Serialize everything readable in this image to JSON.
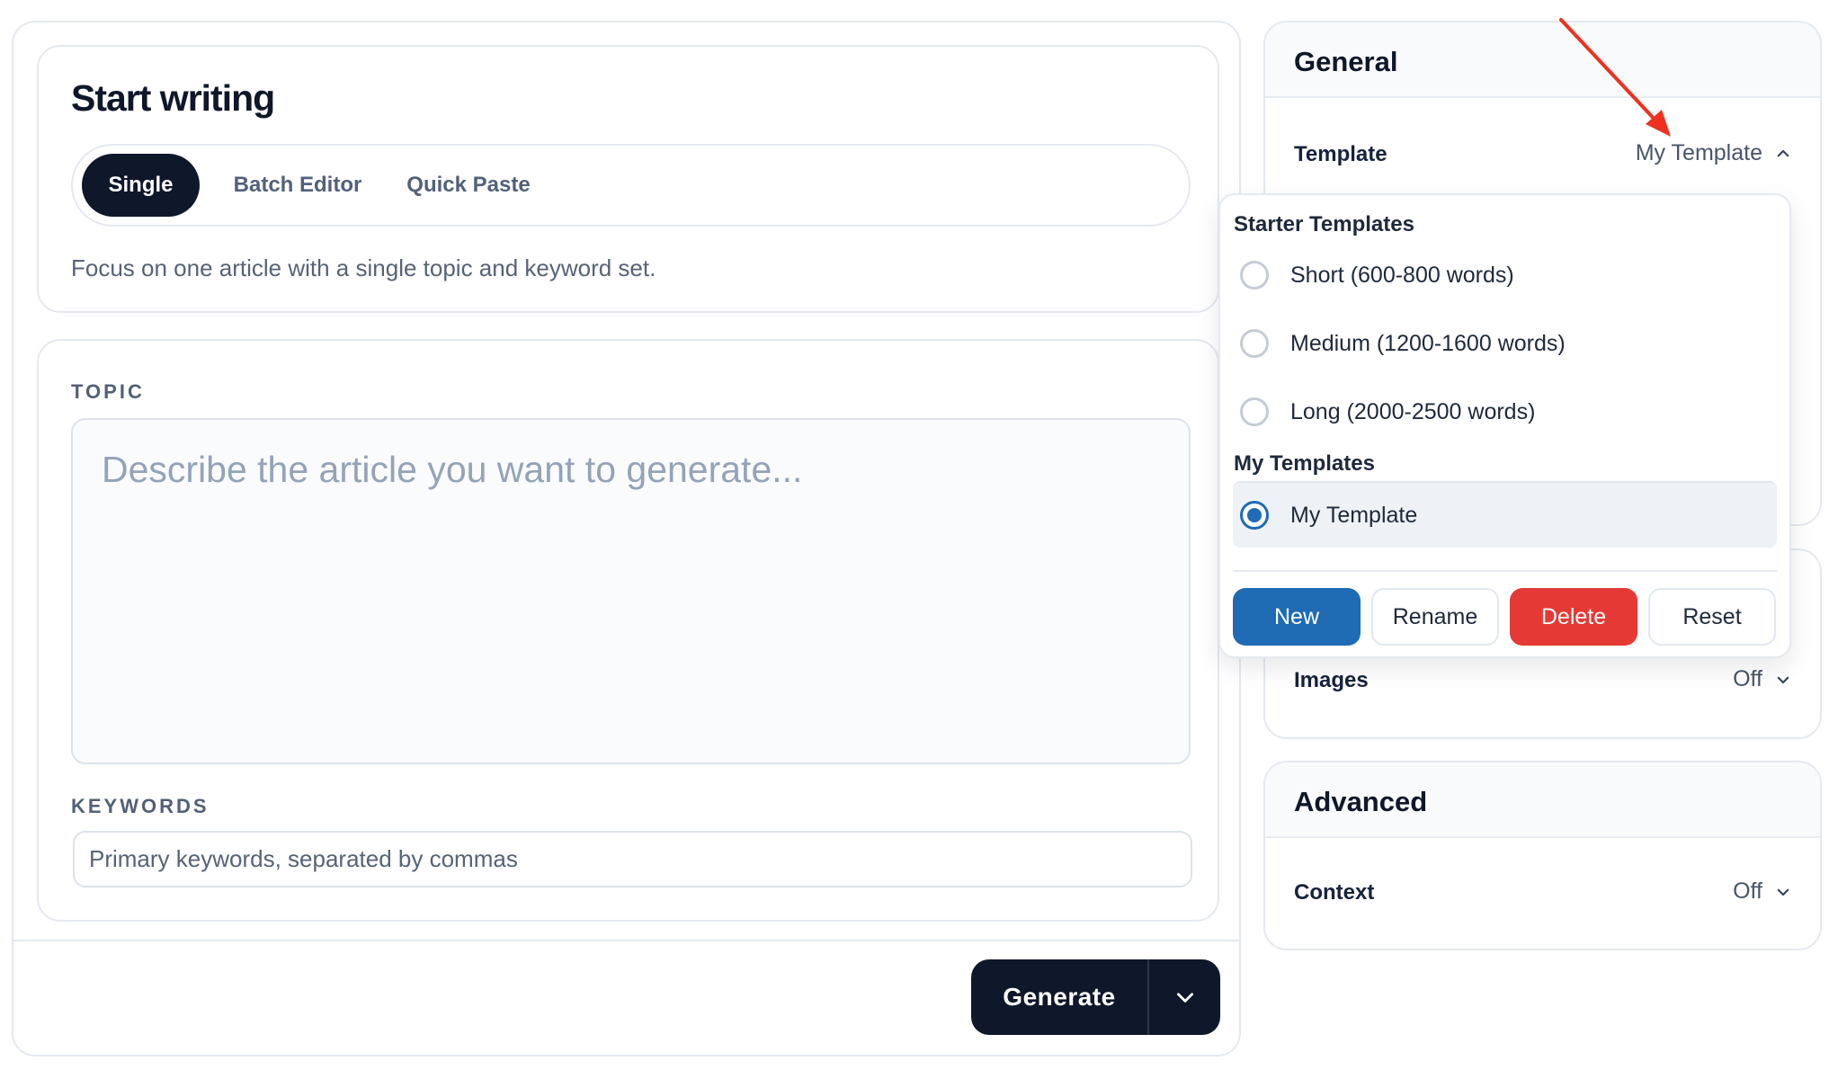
{
  "start": {
    "title": "Start writing",
    "tabs": [
      {
        "label": "Single",
        "active": true
      },
      {
        "label": "Batch Editor",
        "active": false
      },
      {
        "label": "Quick Paste",
        "active": false
      }
    ],
    "description": "Focus on one article with a single topic and keyword set."
  },
  "form": {
    "topic_label": "TOPIC",
    "topic_placeholder": "Describe the article you want to generate...",
    "keywords_label": "KEYWORDS",
    "keywords_placeholder": "Primary keywords, separated by commas"
  },
  "actions": {
    "generate_label": "Generate",
    "generate_menu_icon": "chevron-down-icon"
  },
  "sidebar": {
    "general": {
      "title": "General",
      "template_label": "Template",
      "template_value": "My Template",
      "template_expanded": true
    },
    "images": {
      "label": "Images",
      "value": "Off"
    },
    "advanced": {
      "title": "Advanced",
      "context_label": "Context",
      "context_value": "Off"
    }
  },
  "template_dropdown": {
    "starter_heading": "Starter Templates",
    "starter_options": [
      {
        "label": "Short (600-800 words)",
        "selected": false
      },
      {
        "label": "Medium (1200-1600 words)",
        "selected": false
      },
      {
        "label": "Long (2000-2500 words)",
        "selected": false
      }
    ],
    "my_heading": "My Templates",
    "my_options": [
      {
        "label": "My Template",
        "selected": true
      }
    ],
    "buttons": {
      "new": "New",
      "rename": "Rename",
      "delete": "Delete",
      "reset": "Reset"
    }
  },
  "colors": {
    "primary_dark": "#0f172a",
    "accent_blue": "#1f6bb4",
    "danger_red": "#e53935",
    "annotation_arrow": "#f0301f"
  }
}
